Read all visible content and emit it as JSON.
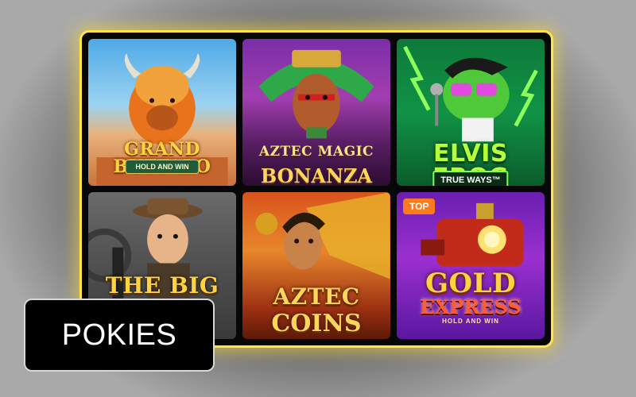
{
  "label": "POKIES",
  "colors": {
    "panel_border": "#ffe44d",
    "badge": "#ff7a1a"
  },
  "games": [
    {
      "name_line1": "GRAND BUFFALO",
      "subtitle": "HOLD AND WIN",
      "icon": "buffalo"
    },
    {
      "name_line1": "AZTEC MAGIC",
      "name_line2": "BONANZA",
      "icon": "aztec-warrior"
    },
    {
      "name_line1": "ELVIS FROG",
      "subtitle": "TRUE WAYS™",
      "icon": "frog"
    },
    {
      "name_line1": "THE BIG",
      "icon": "gangster"
    },
    {
      "name_line1": "AZTEC",
      "name_line2": "COINS",
      "icon": "aztec-queen"
    },
    {
      "badge": "TOP",
      "name_line1": "GOLD",
      "name_line2": "EXPRESS",
      "subtitle": "HOLD AND WIN",
      "icon": "train"
    }
  ]
}
